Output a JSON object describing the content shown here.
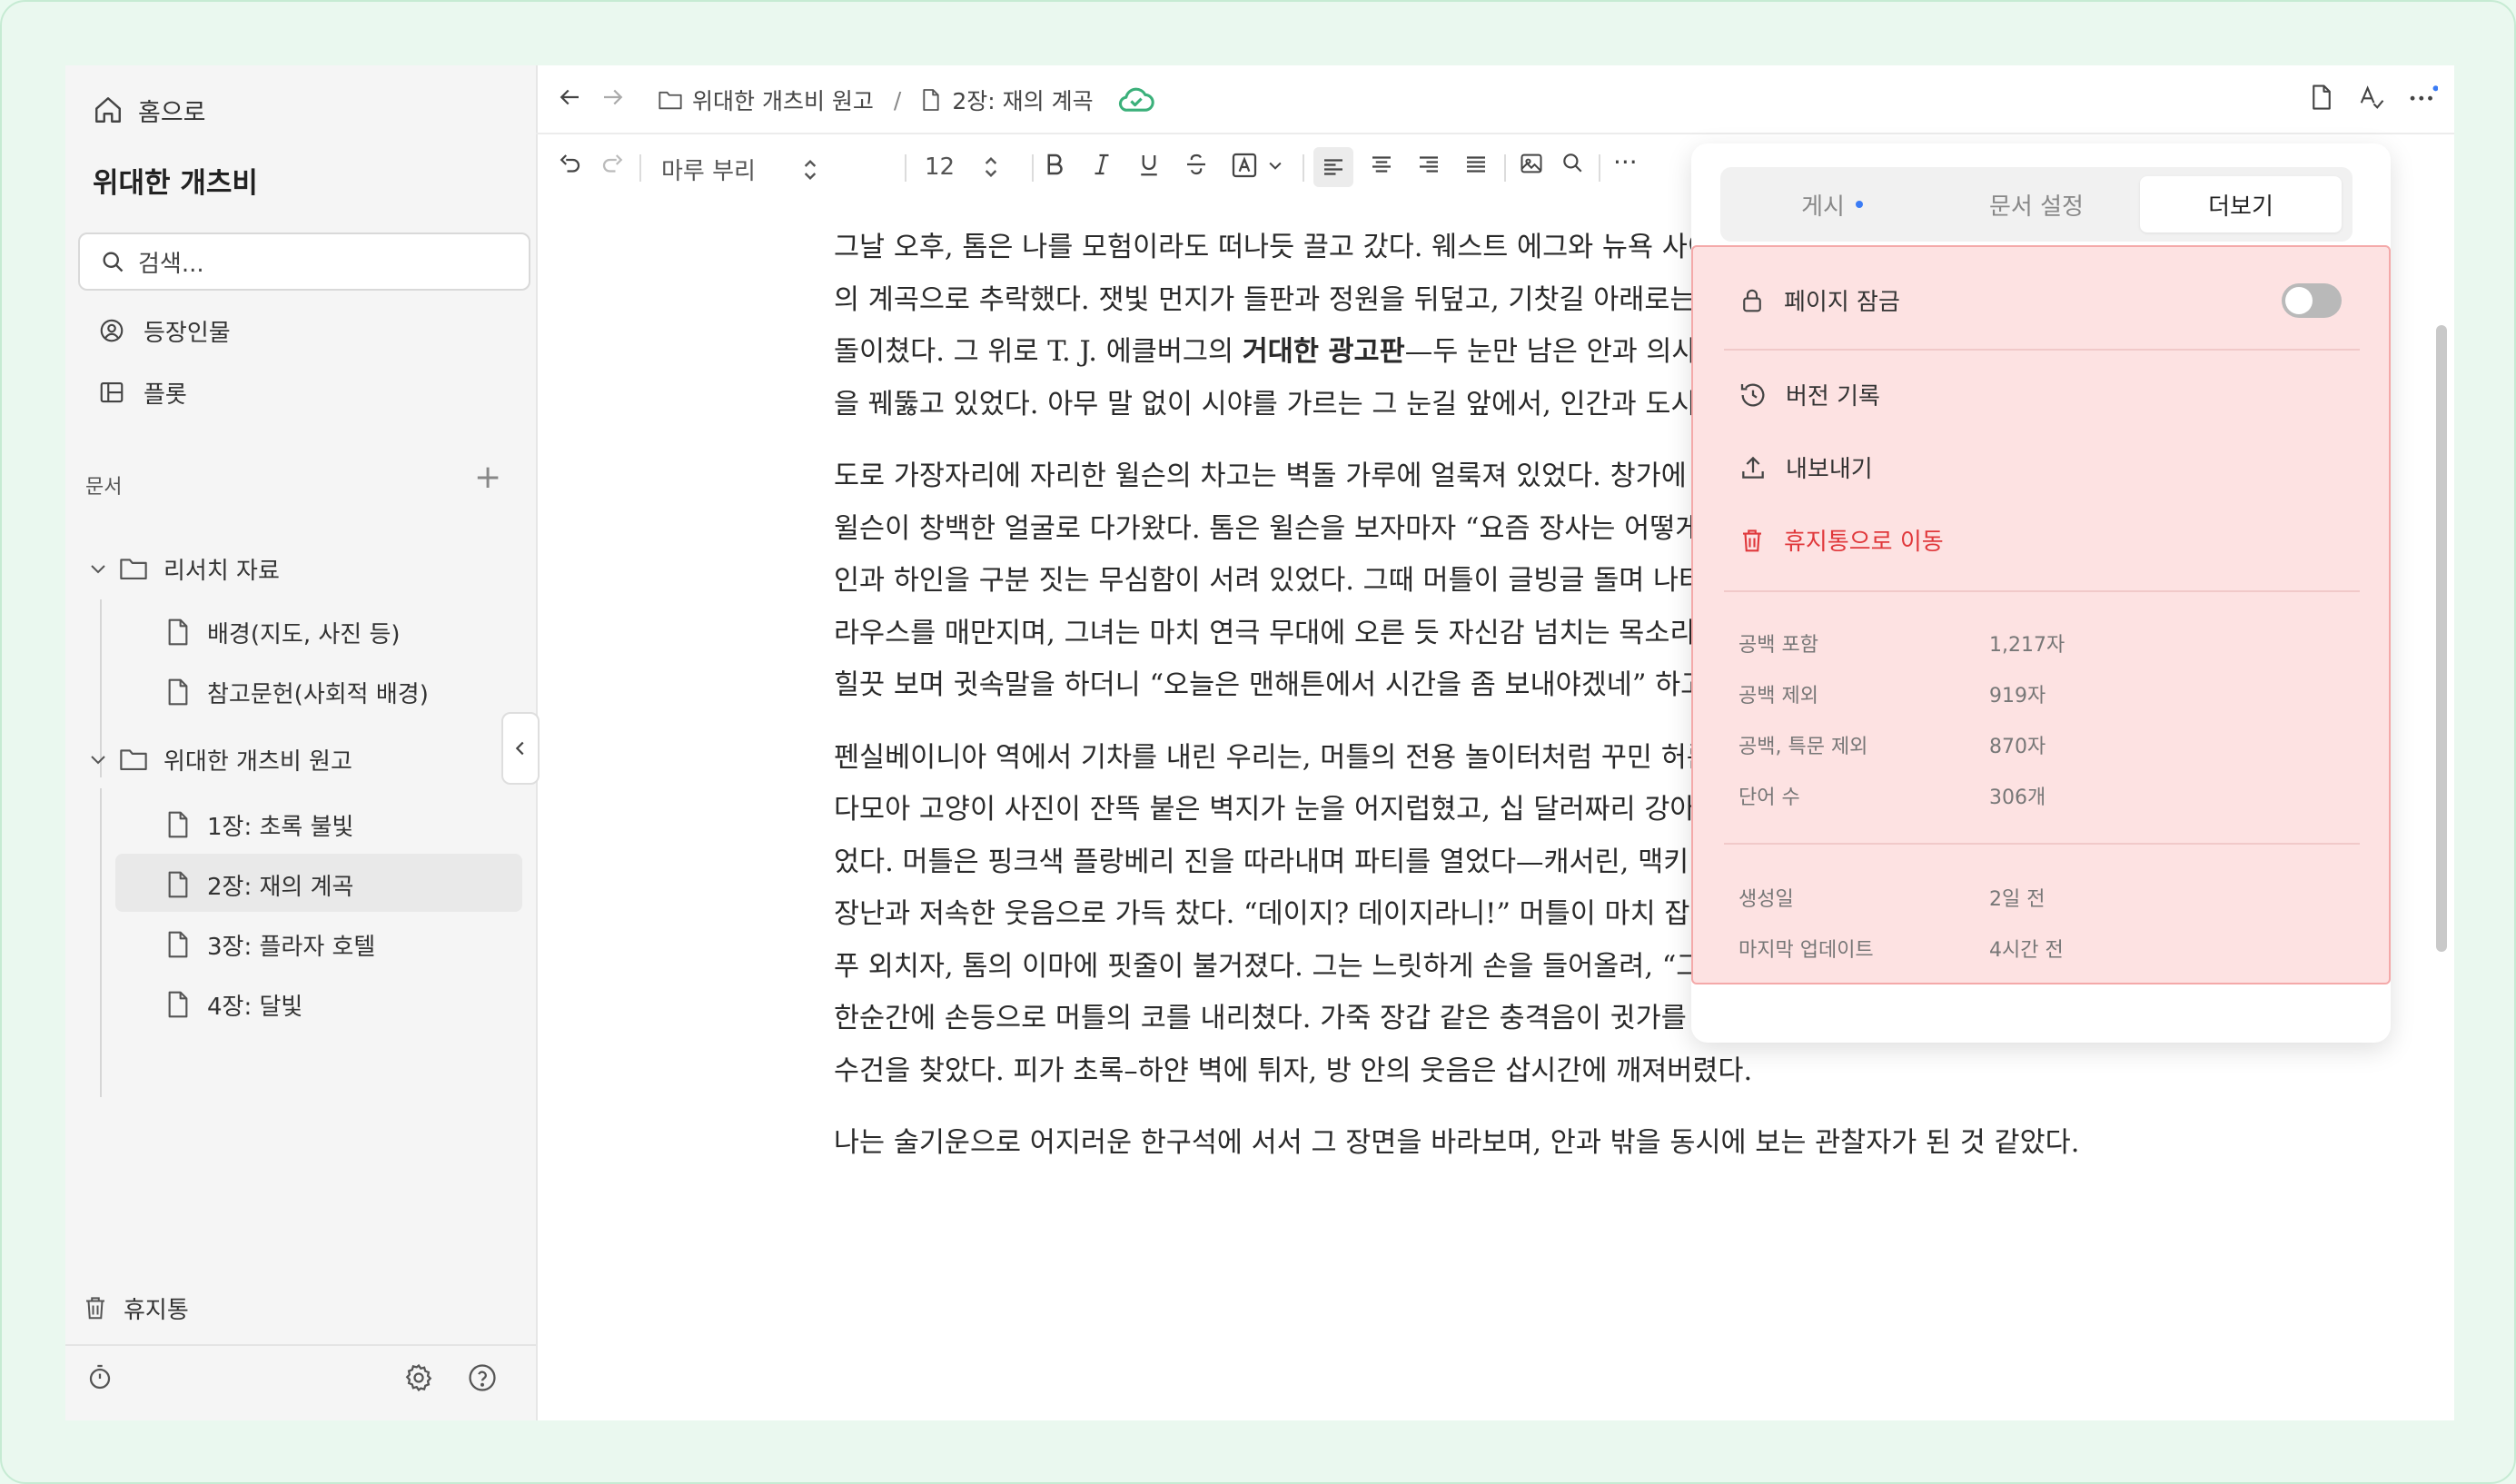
{
  "sidebar": {
    "home_label": "홈으로",
    "workspace_title": "위대한 개츠비",
    "search_placeholder": "검색...",
    "nav": [
      {
        "label": "등장인물",
        "icon": "person-circle-icon"
      },
      {
        "label": "플롯",
        "icon": "layout-icon"
      }
    ],
    "docs_section_label": "문서",
    "add_label": "+",
    "folders": [
      {
        "label": "리서치 자료",
        "items": [
          "배경(지도, 사진 등)",
          "참고문헌(사회적 배경)"
        ]
      },
      {
        "label": "위대한 개츠비 원고",
        "items": [
          "1장: 초록 불빛",
          "2장: 재의 계곡",
          "3장: 플라자 호텔",
          "4장: 달빛"
        ]
      }
    ],
    "selected_item": "2장: 재의 계곡",
    "trash_label": "휴지통"
  },
  "header": {
    "breadcrumb_folder": "위대한 개츠비 원고",
    "breadcrumb_sep": "/",
    "breadcrumb_doc": "2장: 재의 계곡"
  },
  "toolbar": {
    "font_name": "마루 부리",
    "font_size": "12",
    "more": "···"
  },
  "document": {
    "paragraphs": [
      {
        "before": "그날 오후, 톰은 나를 모험이라도 떠나듯 끌고 갔다. 웨스트 에그와 뉴욕 사이, 언덕을 돌아섰을 때, 풍경은 돌연 재의 계곡으로 추락했다. 잿빛 먼지가 들판과 정원을 뒤덮고, 기찻길 아래로는 폐석탄 가루가 흘러내려 조용히 소용돌이쳤다. 그 위로 T. J. 에클버그의 ",
        "bold": "거대한 광고판",
        "after": "—두 눈만 남은 안과 의사의 안경 테 안에서 거대한 두 눈이 하늘을 꿰뚫고 있었다. 아무 말 없이 시야를 가르는 그 눈길 앞에서, 인간과 도시는 모두 작아 보였다."
      },
      {
        "text": "도로 가장자리에 자리한 윌슨의 차고는 벽돌 가루에 얼룩져 있었다. 창가에 서 있던 그림자뿐, 안쪽으로 더스 베어 윌슨이 창백한 얼굴로 다가왔다. 톰은 윌슨을 보자마자 “요즘 장사는 어떻게 돼 비됐나?”라고 물었다. 목소리엔 주인과 하인을 구분 짓는 무심함이 서려 있었다. 그때 머틀이 글빙글 돌며 나타났다. 살집 있는 몸에 저렴한 실크 블라우스를 매만지며, 그녀는 마치 연극 무대에 오른 듯 자신감 넘치는 목소리로 뉴욕 이야기를 꺼냈다. 톰은 그녀를 힐끗 보며 귓속말을 하더니 “오늘은 맨해튼에서 시간을 좀 보내야겠네” 하고 선언했다."
      },
      {
        "text": "펜실베이니아 역에서 기차를 내린 우리는, 머틀의 전용 놀이터처럼 꾸민 허름한 아파트로 올라갔다. 좁은 거실엔 다모아 고양이 사진이 잔뜩 붙은 벽지가 눈을 어지럽혔고, 십 달러짜리 강아지가 낑낑대며 새 신발을 물어뜯고 있었다. 머틀은 핑크색 플랑베리 진을 따라내며 파티를 열었다—캐서린, 맥키 부부가 합류하고, 방 안은 싱그러운 말장난과 저속한 웃음으로 가득 찼다. “데이지? 데이지라니!” 머틀이 마치 잡지 제목이라도 되는 듯 그 이름을 연거푸 외치자, 톰의 이마에 핏줄이 불거졌다. 그는 느릿하게 손을 들어올려, “그 이름 입에 올리지 마.” 그렇게 말하곤 한순간에 손등으로 머틀의 코를 내리쳤다. 가죽 장갑 같은 충격음이 귓가를 울렸고, 머틀은 비명을 지르며 붉은 손수건을 찾았다. 피가 초록–하얀 벽에 튀자, 방 안의 웃음은 삽시간에 깨져버렸다."
      },
      {
        "text": "나는 술기운으로 어지러운 한구석에 서서 그 장면을 바라보며, 안과 밖을 동시에 보는 관찰자가 된 것 같았다."
      }
    ]
  },
  "popover": {
    "tabs": [
      {
        "label": "게시",
        "has_dot": true
      },
      {
        "label": "문서 설정",
        "has_dot": false
      },
      {
        "label": "더보기",
        "has_dot": false
      }
    ],
    "active_tab": "더보기",
    "page_lock_label": "페이지 잠금",
    "page_lock_on": false,
    "version_history_label": "버전 기록",
    "export_label": "내보내기",
    "trash_label": "휴지통으로 이동",
    "stats": [
      {
        "label": "공백 포함",
        "value": "1,217자"
      },
      {
        "label": "공백 제외",
        "value": "919자"
      },
      {
        "label": "공백, 특문 제외",
        "value": "870자"
      },
      {
        "label": "단어 수",
        "value": "306개"
      }
    ],
    "meta": [
      {
        "label": "생성일",
        "value": "2일 전"
      },
      {
        "label": "마지막 업데이트",
        "value": "4시간 전"
      }
    ]
  },
  "colors": {
    "accent_green": "#3bb07a",
    "danger_red": "#e0383b",
    "panel_highlight": "#fde2e2",
    "dot_blue": "#3b7cf5"
  }
}
